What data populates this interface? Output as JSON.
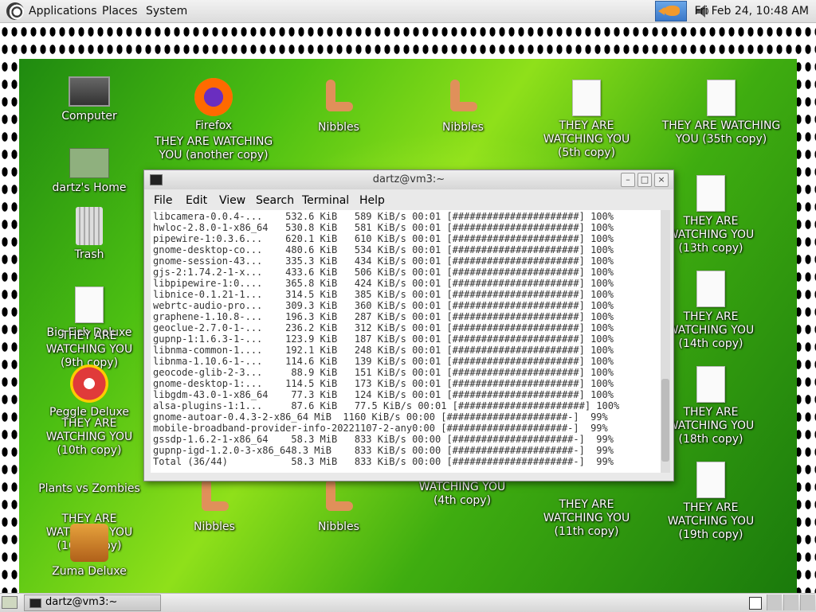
{
  "top_panel": {
    "menus": [
      "Applications",
      "Places",
      "System"
    ],
    "clock": "Fri Feb 24, 10:48 AM"
  },
  "desktop_icons": [
    {
      "label": "Computer",
      "icon": "computer-icon"
    },
    {
      "label": "dartz's Home",
      "icon": "home-folder-icon"
    },
    {
      "label": "Trash",
      "icon": "trash-icon"
    },
    {
      "label": "Big Fish Deluxe",
      "icon": "game-icon"
    },
    {
      "label": "THEY ARE WATCHING YOU (9th copy)",
      "icon": "document-icon"
    },
    {
      "label": "Peggle Deluxe",
      "icon": "peggle-icon"
    },
    {
      "label": "THEY ARE WATCHING YOU (10th copy)",
      "icon": "document-icon"
    },
    {
      "label": "Plants vs Zombies",
      "icon": "plants-icon"
    },
    {
      "label": "THEY ARE WATCHING YOU (16th copy)",
      "icon": "document-icon"
    },
    {
      "label": "Zuma Deluxe",
      "icon": "zuma-icon"
    },
    {
      "label": "Firefox",
      "icon": "firefox-icon"
    },
    {
      "label": "THEY ARE WATCHING YOU (another copy)",
      "icon": "document-icon"
    },
    {
      "label": "Nibbles",
      "icon": "worm-icon"
    },
    {
      "label": "Nibbles",
      "icon": "worm-icon"
    },
    {
      "label": "THEY ARE WATCHING YOU (5th copy)",
      "icon": "document-icon"
    },
    {
      "label": "THEY ARE WATCHING YOU (35th copy)",
      "icon": "document-icon"
    },
    {
      "label": "THEY ARE WATCHING YOU (13th copy)",
      "icon": "document-icon"
    },
    {
      "label": "THEY ARE WATCHING YOU (14th copy)",
      "icon": "document-icon"
    },
    {
      "label": "THEY ARE WATCHING YOU (18th copy)",
      "icon": "document-icon"
    },
    {
      "label": "THEY ARE WATCHING YOU (19th copy)",
      "icon": "document-icon"
    },
    {
      "label": "THEY ARE WATCHING YOU (11th copy)",
      "icon": "document-icon"
    },
    {
      "label": "WATCHING YOU (4th copy)",
      "icon": "document-icon"
    },
    {
      "label": "Nibbles",
      "icon": "worm-icon"
    },
    {
      "label": "Nibbles",
      "icon": "worm-icon"
    }
  ],
  "terminal": {
    "title": "dartz@vm3:~",
    "menu": [
      "File",
      "Edit",
      "View",
      "Search",
      "Terminal",
      "Help"
    ],
    "lines": [
      "libcamera-0.0.4-...    532.6 KiB   589 KiB/s 00:01 [######################] 100%",
      "hwloc-2.8.0-1-x86_64   530.8 KiB   581 KiB/s 00:01 [######################] 100%",
      "pipewire-1:0.3.6...    620.1 KiB   610 KiB/s 00:01 [######################] 100%",
      "gnome-desktop-co...    480.6 KiB   534 KiB/s 00:01 [######################] 100%",
      "gnome-session-43...    335.3 KiB   434 KiB/s 00:01 [######################] 100%",
      "gjs-2:1.74.2-1-x...    433.6 KiB   506 KiB/s 00:01 [######################] 100%",
      "libpipewire-1:0....    365.8 KiB   424 KiB/s 00:01 [######################] 100%",
      "libnice-0.1.21-1...    314.5 KiB   385 KiB/s 00:01 [######################] 100%",
      "webrtc-audio-pro...    309.3 KiB   360 KiB/s 00:01 [######################] 100%",
      "graphene-1.10.8-...    196.3 KiB   287 KiB/s 00:01 [######################] 100%",
      "geoclue-2.7.0-1-...    236.2 KiB   312 KiB/s 00:01 [######################] 100%",
      "gupnp-1:1.6.3-1-...    123.9 KiB   187 KiB/s 00:01 [######################] 100%",
      "libnma-common-1....    192.1 KiB   248 KiB/s 00:01 [######################] 100%",
      "libnma-1.10.6-1-...    114.6 KiB   139 KiB/s 00:01 [######################] 100%",
      "geocode-glib-2-3...     88.9 KiB   151 KiB/s 00:01 [######################] 100%",
      "gnome-desktop-1:...    114.5 KiB   173 KiB/s 00:01 [######################] 100%",
      "libgdm-43.0-1-x86_64    77.3 KiB   124 KiB/s 00:01 [######################] 100%",
      "alsa-plugins-1:1...     87.6 KiB   77.5 KiB/s 00:01 [######################] 100%",
      "gnome-autoar-0.4.3-2-x86_64 MiB  1160 KiB/s 00:00 [#####################-]  99%",
      "mobile-broadband-provider-info-20221107-2-any0:00 [#####################-]  99%",
      "gssdp-1.6.2-1-x86_64    58.3 MiB   833 KiB/s 00:00 [#####################-]  99%",
      "gupnp-igd-1.2.0-3-x86_648.3 MiB    833 KiB/s 00:00 [#####################-]  99%",
      "Total (36/44)           58.3 MiB   833 KiB/s 00:00 [#####################-]  99%"
    ]
  },
  "bottom_panel": {
    "task_label": "dartz@vm3:~"
  },
  "colors": {
    "wallpaper_green": "#4cbf12",
    "panel_gray": "#e0e0e0"
  }
}
